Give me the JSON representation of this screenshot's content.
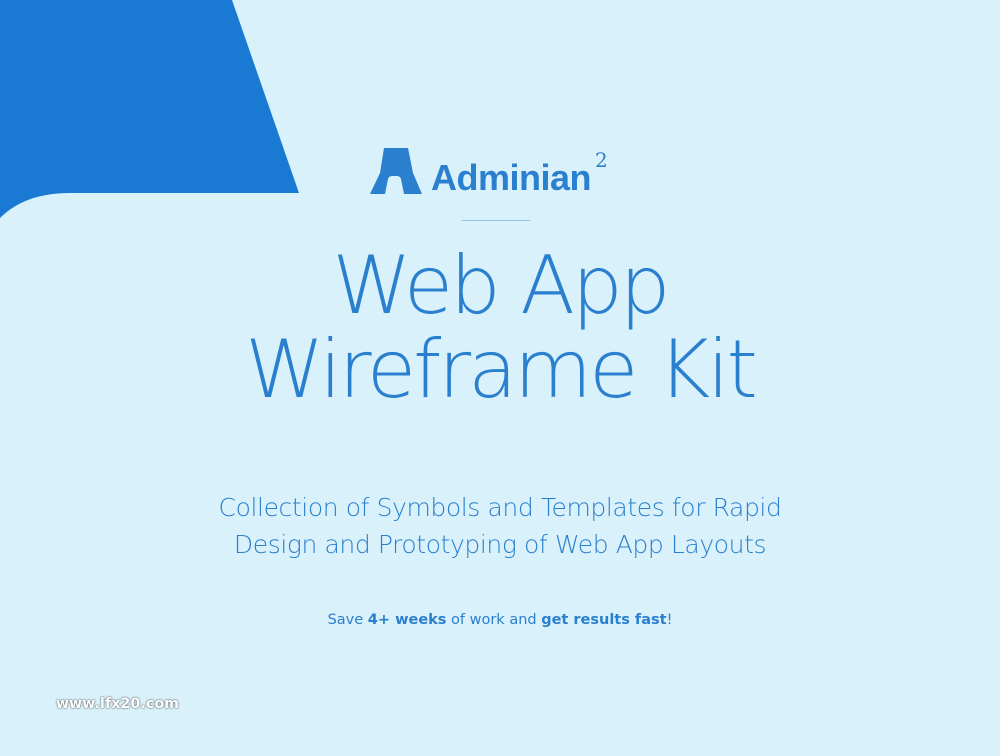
{
  "colors": {
    "background": "#d9f1fa",
    "accent": "#1a7ad3",
    "text": "#2a7fce",
    "divider": "#8ec4ea"
  },
  "logo": {
    "icon": "adminian-logo-icon",
    "name": "Adminian",
    "superscript": "2"
  },
  "headline": {
    "line1": "Web App",
    "line2": "Wireframe Kit"
  },
  "subtitle": {
    "line1": "Collection of Symbols and Templates for Rapid",
    "line2": "Design and Prototyping of Web App Layouts"
  },
  "tagline": {
    "part1": "Save ",
    "bold1": "4+ weeks",
    "part2": " of work and ",
    "bold2": "get results fast",
    "part3": "!"
  },
  "watermark": "www.lfx20.com"
}
